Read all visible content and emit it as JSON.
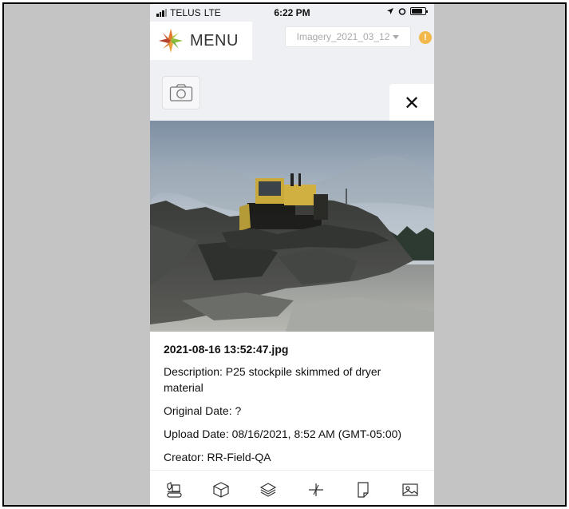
{
  "status_bar": {
    "carrier": "TELUS",
    "network": "LTE",
    "time": "6:22 PM"
  },
  "header": {
    "menu_label": "MENU",
    "imagery_select": "Imagery_2021_03_12",
    "warning_glyph": "!"
  },
  "panel": {
    "close_glyph": "✕"
  },
  "photo_info": {
    "filename": "2021-08-16 13:52:47.jpg",
    "description": "Description: P25 stockpile skimmed of dryer material",
    "original_date": "Original Date: ?",
    "upload_date": "Upload Date: 08/16/2021, 8:52 AM (GMT-05:00)",
    "creator": "Creator: RR-Field-QA"
  },
  "toolbar": {
    "items": [
      {
        "icon": "excavator-icon"
      },
      {
        "icon": "cube-icon"
      },
      {
        "icon": "layers-icon"
      },
      {
        "icon": "measure-icon"
      },
      {
        "icon": "note-icon"
      },
      {
        "icon": "image-icon"
      }
    ]
  },
  "colors": {
    "app_background": "#eef0f4",
    "warning": "#f2b84b",
    "frame_background": "#c4c4c4"
  }
}
